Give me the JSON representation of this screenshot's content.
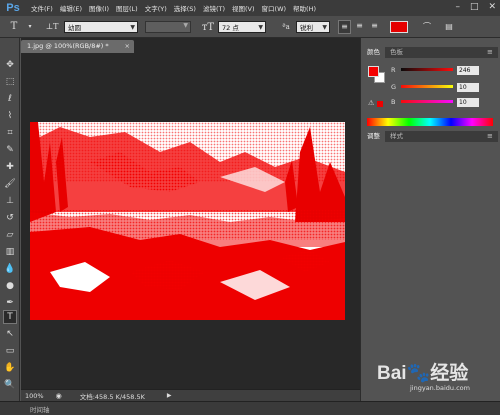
{
  "app": {
    "logo_text": "Ps"
  },
  "menu": {
    "items": [
      "文件(F)",
      "编辑(E)",
      "图像(I)",
      "图层(L)",
      "文字(Y)",
      "选择(S)",
      "滤镜(T)",
      "视图(V)",
      "窗口(W)",
      "帮助(H)"
    ]
  },
  "options_bar": {
    "font_family": "幼圆",
    "font_size": "72 点",
    "antialias": "锐利",
    "text_color": "#e50000"
  },
  "document": {
    "tab_title": "1.jpg @ 100%(RGB/8#) *",
    "close_label": "×"
  },
  "status_bar": {
    "zoom": "100%",
    "doc_info": "文档:458.5 K/458.5K"
  },
  "color_panel": {
    "tabs": [
      "颜色",
      "色板"
    ],
    "fg_color": "#f40000",
    "bg_color": "#ffffff",
    "channels": [
      {
        "label": "R",
        "value": "246"
      },
      {
        "label": "G",
        "value": "10"
      },
      {
        "label": "B",
        "value": "10"
      }
    ]
  },
  "adjust_panel": {
    "tabs": [
      "调整",
      "样式"
    ]
  },
  "timeline": {
    "label": "时间轴"
  },
  "watermark": {
    "brand": "Bai🐾经验",
    "url": "jingyan.baidu.com"
  }
}
